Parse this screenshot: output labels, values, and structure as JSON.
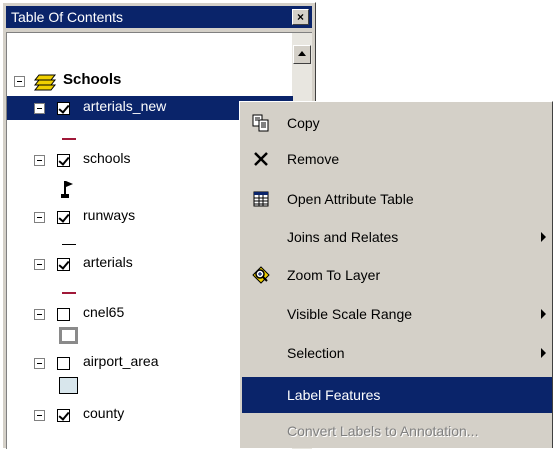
{
  "window": {
    "title": "Table Of Contents",
    "close_glyph": "×"
  },
  "tree": {
    "root_label": "Schools",
    "layers": [
      {
        "label": "arterials_new",
        "checked": true,
        "selected": true
      },
      {
        "label": "schools",
        "checked": true
      },
      {
        "label": "runways",
        "checked": true
      },
      {
        "label": "arterials",
        "checked": true
      },
      {
        "label": "cnel65",
        "checked": false
      },
      {
        "label": "airport_area",
        "checked": false
      },
      {
        "label": "county",
        "checked": true
      }
    ]
  },
  "context_menu": {
    "items": [
      {
        "label": "Copy",
        "icon": "copy-icon"
      },
      {
        "label": "Remove",
        "icon": "remove-icon"
      },
      {
        "label": "Open Attribute Table",
        "icon": "table-icon"
      },
      {
        "label": "Joins and Relates",
        "submenu": true
      },
      {
        "label": "Zoom To Layer",
        "icon": "zoom-to-layer-icon"
      },
      {
        "label": "Visible Scale Range",
        "submenu": true
      },
      {
        "label": "Selection",
        "submenu": true
      },
      {
        "label": "Label Features",
        "highlighted": true
      },
      {
        "label": "Convert Labels to Annotation...",
        "disabled": true
      }
    ]
  },
  "colors": {
    "selection": "#0a246a",
    "face": "#d4d0c8",
    "arterials_new_symbol": "#a01838",
    "arterials_symbol": "#a01838",
    "cnel65_outline": "#8a8a8a",
    "airport_area_fill": "#d8e6ec"
  }
}
